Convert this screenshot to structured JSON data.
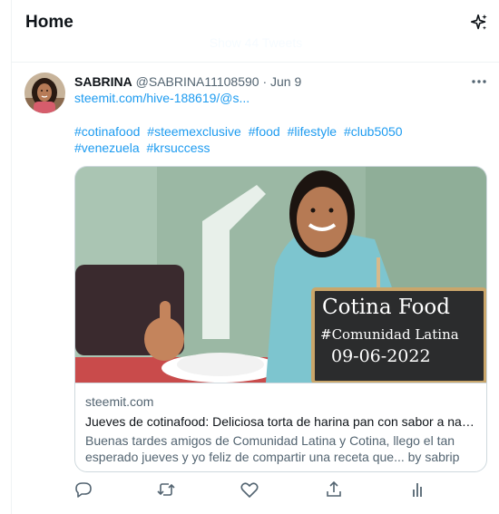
{
  "header": {
    "title": "Home",
    "sparkle_icon": "sparkle-icon"
  },
  "timeline": {
    "show_more": "Show 44 Tweets"
  },
  "tweet": {
    "author_name": "SABRINA",
    "author_handle": "@SABRINA11108590",
    "separator": "·",
    "date": "Jun 9",
    "link": "steemit.com/hive-188619/@s...",
    "hashtags": [
      "#cotinafood",
      "#steemexclusive",
      "#food",
      "#lifestyle",
      "#club5050",
      "#venezuela",
      "#krsuccess"
    ],
    "card": {
      "image_sign_lines": [
        "Cotina Food",
        "#Comunidad Latina",
        "09-06-2022"
      ],
      "domain": "steemit.com",
      "title": "Jueves de cotinafood: Deliciosa torta de harina pan con sabor a naranja",
      "description": "Buenas tardes amigos de Comunidad Latina y Cotina, llego el tan esperado jueves y yo feliz de compartir una receta que... by sabrip"
    },
    "actions": [
      "reply-icon",
      "retweet-icon",
      "like-icon",
      "share-icon",
      "analytics-icon"
    ]
  },
  "colors": {
    "accent": "#1d9bf0",
    "text": "#0f1419",
    "secondary": "#536471",
    "border": "#cfd9de"
  }
}
